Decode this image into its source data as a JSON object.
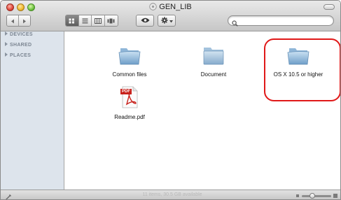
{
  "window": {
    "title": "GEN_LIB",
    "status_text": "11 items, 30.5 GB available"
  },
  "toolbar": {
    "back_icon": "back-arrow-icon",
    "forward_icon": "forward-arrow-icon",
    "views": [
      "icon-view",
      "list-view",
      "column-view",
      "coverflow-view"
    ],
    "active_view": "icon-view",
    "search": {
      "value": "",
      "placeholder": ""
    }
  },
  "sidebar": {
    "sections": [
      {
        "label": "DEVICES"
      },
      {
        "label": "SHARED"
      },
      {
        "label": "PLACES"
      }
    ]
  },
  "files": [
    {
      "name": "Common files",
      "type": "folder",
      "icon": "folder-icon"
    },
    {
      "name": "Document",
      "type": "folder",
      "icon": "folder-icon"
    },
    {
      "name": "OS X 10.5 or higher",
      "type": "folder",
      "icon": "folder-icon",
      "highlighted": true
    },
    {
      "name": "Readme.pdf",
      "type": "pdf",
      "icon": "pdf-icon",
      "badge": "PDF"
    }
  ],
  "colors": {
    "highlight_ring": "#e01818",
    "sidebar_bg": "#dde4ec",
    "pdf_red": "#c8211b"
  }
}
